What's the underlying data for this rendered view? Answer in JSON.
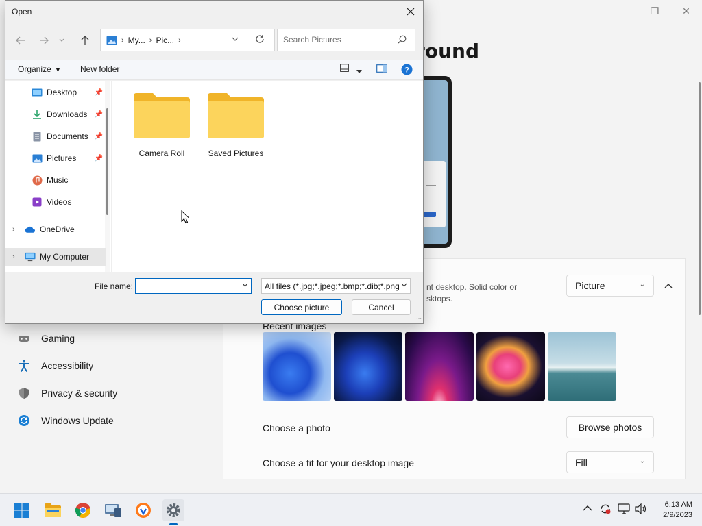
{
  "settings": {
    "page_title": "ground",
    "desc_line1": "nt desktop. Solid color or",
    "desc_line2": "sktops.",
    "background_select": "Picture",
    "recent_label": "Recent images",
    "photo_label": "Choose a photo",
    "browse_label": "Browse photos",
    "fit_label": "Choose a fit for your desktop image",
    "fit_select": "Fill",
    "nav": [
      {
        "label": "Gaming",
        "icon": "gamepad-icon"
      },
      {
        "label": "Accessibility",
        "icon": "accessibility-icon"
      },
      {
        "label": "Privacy & security",
        "icon": "shield-icon"
      },
      {
        "label": "Windows Update",
        "icon": "update-icon"
      }
    ],
    "colors": {
      "accent": "#0067c0"
    }
  },
  "dialog": {
    "title": "Open",
    "address": [
      "My...",
      "Pic..."
    ],
    "search_placeholder": "Search Pictures",
    "organize_label": "Organize",
    "new_folder_label": "New folder",
    "nav_items": [
      {
        "label": "Desktop",
        "icon": "desktop-icon",
        "pinned": true
      },
      {
        "label": "Downloads",
        "icon": "download-icon",
        "pinned": true
      },
      {
        "label": "Documents",
        "icon": "documents-icon",
        "pinned": true
      },
      {
        "label": "Pictures",
        "icon": "pictures-icon",
        "pinned": true
      },
      {
        "label": "Music",
        "icon": "music-icon",
        "pinned": false
      },
      {
        "label": "Videos",
        "icon": "videos-icon",
        "pinned": false
      },
      {
        "label": "OneDrive",
        "icon": "cloud-icon",
        "pinned": false
      },
      {
        "label": "My Computer",
        "icon": "computer-icon",
        "pinned": false
      }
    ],
    "folders": [
      "Camera Roll",
      "Saved Pictures"
    ],
    "filename_label": "File name:",
    "filename_value": "",
    "filetype_value": "All files (*.jpg;*.jpeg;*.bmp;*.dib;*.png",
    "choose_label": "Choose picture",
    "cancel_label": "Cancel"
  },
  "taskbar": {
    "time": "6:13 AM",
    "date": "2/9/2023"
  }
}
